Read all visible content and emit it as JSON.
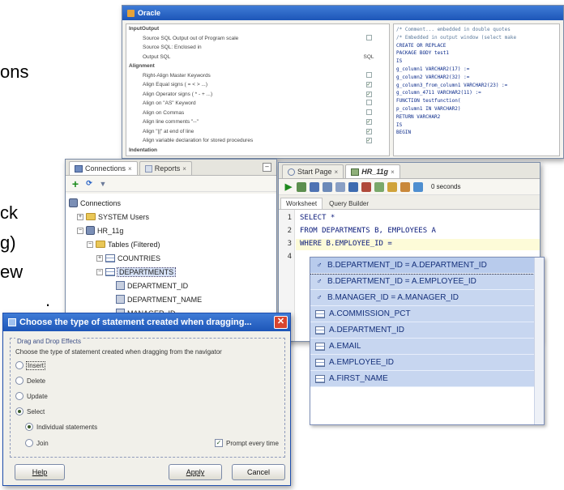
{
  "slide": {
    "frag1": "ons",
    "frag2": "ck",
    "frag3": "g)",
    "frag4": "ew",
    "frag5": "."
  },
  "options_window": {
    "title": "Oracle",
    "rows": [
      {
        "label": "InputOutput",
        "value": ""
      },
      {
        "label": "Source SQL Output out of Program scale",
        "value": "box"
      },
      {
        "label": "Source SQL: Enclosed in",
        "value": ""
      },
      {
        "label": "Output SQL",
        "value": "SQL"
      },
      {
        "label": "Alignment",
        "value": ""
      },
      {
        "label": "Right-Align Master Keywords",
        "value": "box"
      },
      {
        "label": "Align Equal signs ( = < > ...)",
        "value": "check"
      },
      {
        "label": "Align Operator signs ( * - + ...)",
        "value": "check"
      },
      {
        "label": "Align on \"AS\" Keyword",
        "value": "box"
      },
      {
        "label": "Align on Commas",
        "value": "box"
      },
      {
        "label": "Align line comments \"--\"",
        "value": "check"
      },
      {
        "label": "Align \"||\" at end of line",
        "value": "check"
      },
      {
        "label": "Align variable declaration for stored procedures",
        "value": "check"
      },
      {
        "label": "Indentation",
        "value": ""
      }
    ],
    "code": [
      "/* Comment... embedded in double quotes",
      "/* Embedded in output window (select make",
      "CREATE OR REPLACE",
      "PACKAGE BODY test1",
      "IS",
      "  g_column1                VARCHAR2(17) :=",
      "  g_column2                VARCHAR2(32) :=",
      "  g_column3_from_column1   VARCHAR2(23) :=",
      "  g_column_4711            VARCHAR2(11) :=",
      "FUNCTION testfunction(",
      "  p_column1 IN VARCHAR2)",
      "  RETURN VARCHAR2",
      "IS",
      "BEGIN"
    ]
  },
  "connections": {
    "tab_connections": "Connections",
    "tab_reports": "Reports",
    "tree": {
      "root": "Connections",
      "system": "SYSTEM Users",
      "conn": "HR_11g",
      "tables": "Tables (Filtered)",
      "countries": "COUNTRIES",
      "departments": "DEPARTMENTS",
      "col1": "DEPARTMENT_ID",
      "col2": "DEPARTMENT_NAME",
      "col3": "MANAGER_ID"
    }
  },
  "sql_window": {
    "tab_start": "Start Page",
    "tab_hr": "HR_11g",
    "timer": "0 seconds",
    "tab_worksheet": "Worksheet",
    "tab_query": "Query Builder",
    "lines": [
      {
        "num": "1",
        "code": "SELECT *"
      },
      {
        "num": "2",
        "code": "FROM DEPARTMENTS B, EMPLOYEES A"
      },
      {
        "num": "3",
        "code": "WHERE B.EMPLOYEE_ID ="
      },
      {
        "num": "4",
        "code": ""
      }
    ]
  },
  "autocomplete": {
    "items": [
      {
        "kind": "join",
        "text": "B.DEPARTMENT_ID = A.DEPARTMENT_ID"
      },
      {
        "kind": "join",
        "text": "B.DEPARTMENT_ID = A.EMPLOYEE_ID"
      },
      {
        "kind": "join",
        "text": "B.MANAGER_ID = A.MANAGER_ID"
      },
      {
        "kind": "col",
        "text": "A.COMMISSION_PCT"
      },
      {
        "kind": "col",
        "text": "A.DEPARTMENT_ID"
      },
      {
        "kind": "col",
        "text": "A.EMAIL"
      },
      {
        "kind": "col",
        "text": "A.EMPLOYEE_ID"
      },
      {
        "kind": "col",
        "text": "A.FIRST_NAME"
      }
    ]
  },
  "dialog": {
    "title": "Choose the type of statement created when dragging...",
    "group_title": "Drag and Drop Effects",
    "prompt": "Choose the type of statement created when dragging from the navigator",
    "opt_insert": "Insert",
    "opt_delete": "Delete",
    "opt_update": "Update",
    "opt_select": "Select",
    "sub_individual": "Individual statements",
    "sub_join": "Join",
    "prompt_every_time": "Prompt every time",
    "btn_help": "Help",
    "btn_apply": "Apply",
    "btn_cancel": "Cancel"
  }
}
